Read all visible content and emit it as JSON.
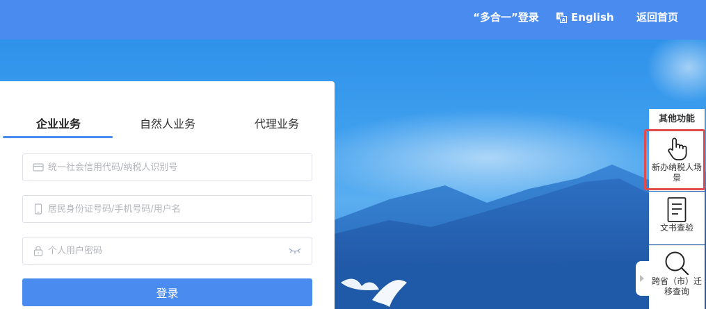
{
  "topbar": {
    "multi_login": "“多合一”登录",
    "language": "English",
    "home": "返回首页"
  },
  "login": {
    "tabs": [
      {
        "label": "企业业务",
        "active": true
      },
      {
        "label": "自然人业务",
        "active": false
      },
      {
        "label": "代理业务",
        "active": false
      }
    ],
    "credit_code_placeholder": "统一社会信用代码/纳税人识别号",
    "account_placeholder": "居民身份证号码/手机号码/用户名",
    "password_placeholder": "个人用户密码",
    "submit": "登录"
  },
  "side_panel": {
    "title": "其他功能",
    "items": [
      {
        "label": "新办纳税人场景",
        "icon": "hand-pointer-icon",
        "highlighted": true
      },
      {
        "label": "文书查验",
        "icon": "document-icon"
      },
      {
        "label": "跨省（市）迁移查询",
        "icon": "search-icon"
      }
    ]
  },
  "colors": {
    "brand": "#4a8bf0",
    "highlight": "#e14b4b",
    "sky": "#3b97e6"
  }
}
